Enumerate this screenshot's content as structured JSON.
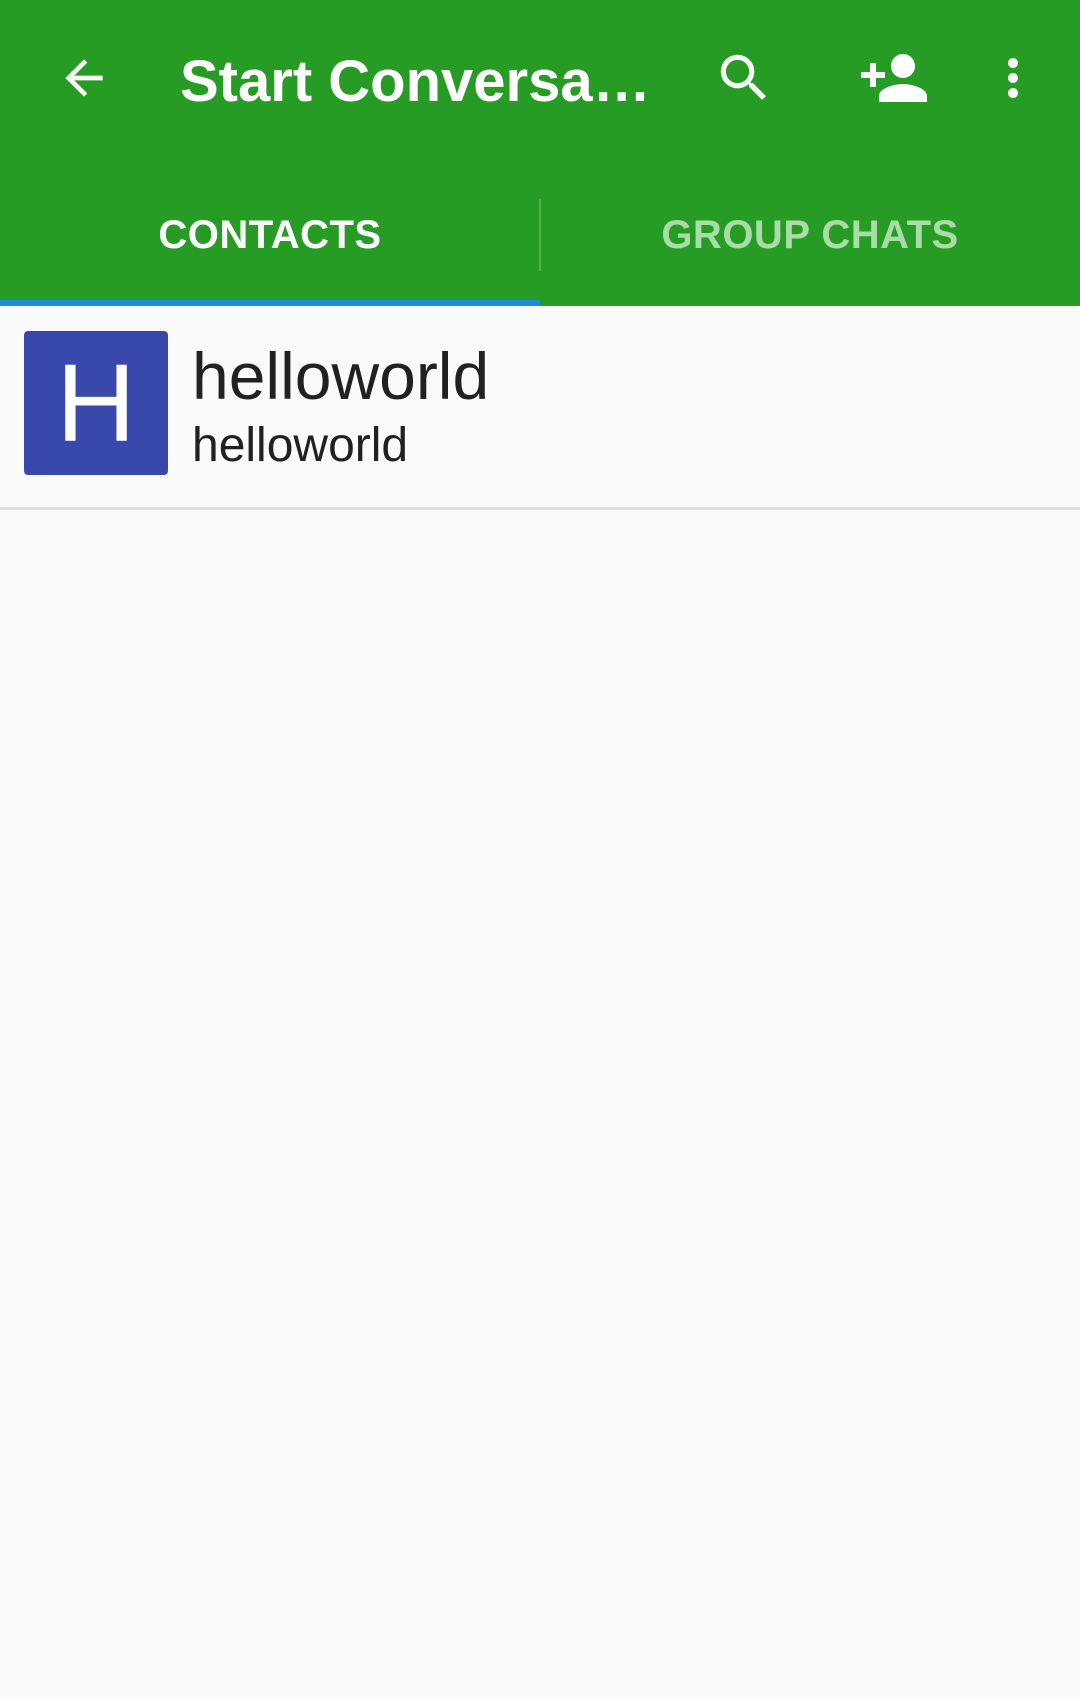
{
  "toolbar": {
    "title": "Start Conversati…",
    "back_icon": "arrow-back-icon",
    "search_icon": "search-icon",
    "add_contact_icon": "person-add-icon",
    "more_icon": "more-vert-icon"
  },
  "tabs": [
    {
      "label": "CONTACTS",
      "selected": true
    },
    {
      "label": "GROUP CHATS",
      "selected": false
    }
  ],
  "contacts": [
    {
      "initial": "H",
      "name": "helloworld",
      "jid": "helloworld",
      "avatar_color": "#3949ab"
    }
  ],
  "colors": {
    "primary": "#279c24",
    "tab_indicator": "#1e88e5",
    "tab_inactive_text": "#a9dca6",
    "background": "#fafafa"
  }
}
